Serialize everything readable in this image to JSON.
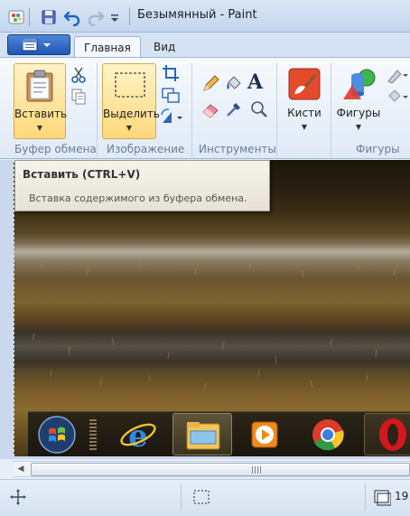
{
  "window": {
    "title": "Безымянный - Paint"
  },
  "ribbon": {
    "tabs": [
      {
        "label": "Главная"
      },
      {
        "label": "Вид"
      }
    ],
    "groups": {
      "clipboard": {
        "label": "Буфер обмена",
        "paste_label": "Вставить"
      },
      "image": {
        "label": "Изображение",
        "select_label": "Выделить"
      },
      "tools": {
        "label": "Инструменты"
      },
      "brushes": {
        "brush_label": "Кисти"
      },
      "shapes": {
        "label": "Фигуры",
        "shapes_label": "Фигуры"
      }
    }
  },
  "tooltip": {
    "title": "Вставить (CTRL+V)",
    "description": "Вставка содержимого из буфера обмена."
  },
  "statusbar": {
    "size_text": "19"
  },
  "colors": {
    "highlight": "#ffd87a",
    "ribbon_bg": "#dfe9f6",
    "app_button": "#1f56b3"
  }
}
